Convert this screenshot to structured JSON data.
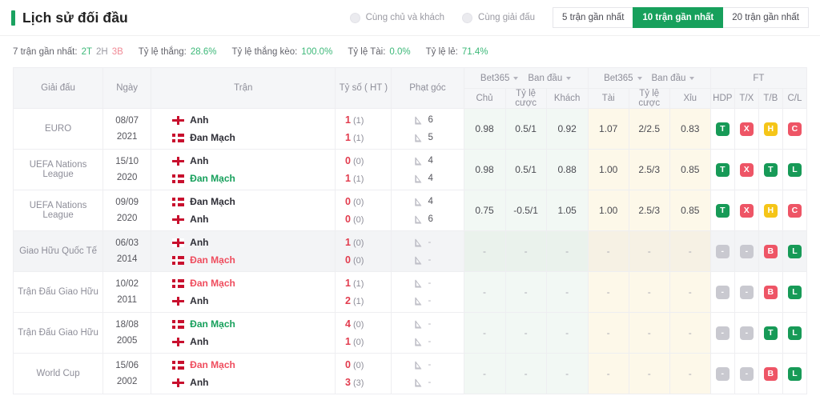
{
  "header": {
    "title": "Lịch sử đối đầu",
    "accent_color": "#1aa260",
    "filters": [
      {
        "name": "same-home-away",
        "label": "Cùng chủ và khách",
        "selected": false
      },
      {
        "name": "same-league",
        "label": "Cùng giải đấu",
        "selected": false
      }
    ],
    "range_buttons": [
      {
        "label": "5 trận gần nhất",
        "active": false
      },
      {
        "label": "10 trận gần nhất",
        "active": true
      },
      {
        "label": "20 trận gần nhất",
        "active": false
      }
    ]
  },
  "stats": {
    "recent_label": "7 trận gần nhất:",
    "wins": "2T",
    "draws": "2H",
    "losses": "3B",
    "win_rate_label": "Tỷ lệ thắng:",
    "win_rate_value": "28.6%",
    "handicap_label": "Tỷ lệ thắng kèo:",
    "handicap_value": "100.0%",
    "over_label": "Tỷ lệ Tài:",
    "over_value": "0.0%",
    "odds_label": "Tỷ lệ lẻ:",
    "odds_value": "71.4%"
  },
  "table": {
    "headers": {
      "league": "Giải đấu",
      "date": "Ngày",
      "match": "Trận",
      "score": "Tỷ số ( HT )",
      "corners": "Phạt góc",
      "group1_book": "Bet365",
      "group1_type": "Ban đầu",
      "group2_book": "Bet365",
      "group2_type": "Ban đầu",
      "ft": "FT",
      "home": "Chủ",
      "odds1": "Tỷ lệ cược",
      "away": "Khách",
      "over": "Tài",
      "odds2": "Tỷ lệ cược",
      "under": "Xỉu",
      "hdp": "HDP",
      "tx": "T/X",
      "tb": "T/B",
      "cl": "C/L"
    },
    "rows": [
      {
        "league": "EURO",
        "day": "08/07",
        "year": "2021",
        "home_team": "Anh",
        "home_flag": "england",
        "home_result": "draw",
        "away_team": "Đan Mạch",
        "away_flag": "denmark",
        "away_result": "draw",
        "home_score": "1",
        "home_ht": "(1)",
        "away_score": "1",
        "away_ht": "(1)",
        "corner_home": "6",
        "corner_away": "5",
        "o_home": "0.98",
        "o_line1": "0.5/1",
        "o_away": "0.92",
        "o_over": "1.07",
        "o_line2": "2/2.5",
        "o_under": "0.83",
        "ft": [
          "T",
          "X",
          "H",
          "C"
        ],
        "highlight": false
      },
      {
        "league": "UEFA Nations League",
        "day": "15/10",
        "year": "2020",
        "home_team": "Anh",
        "home_flag": "england",
        "home_result": "draw",
        "away_team": "Đan Mạch",
        "away_flag": "denmark",
        "away_result": "win",
        "home_score": "0",
        "home_ht": "(0)",
        "away_score": "1",
        "away_ht": "(1)",
        "corner_home": "4",
        "corner_away": "4",
        "o_home": "0.98",
        "o_line1": "0.5/1",
        "o_away": "0.88",
        "o_over": "1.00",
        "o_line2": "2.5/3",
        "o_under": "0.85",
        "ft": [
          "T",
          "X",
          "T",
          "L"
        ],
        "highlight": false
      },
      {
        "league": "UEFA Nations League",
        "day": "09/09",
        "year": "2020",
        "home_team": "Đan Mạch",
        "home_flag": "denmark",
        "home_result": "draw",
        "away_team": "Anh",
        "away_flag": "england",
        "away_result": "draw",
        "home_score": "0",
        "home_ht": "(0)",
        "away_score": "0",
        "away_ht": "(0)",
        "corner_home": "4",
        "corner_away": "6",
        "o_home": "0.75",
        "o_line1": "-0.5/1",
        "o_away": "1.05",
        "o_over": "1.00",
        "o_line2": "2.5/3",
        "o_under": "0.85",
        "ft": [
          "T",
          "X",
          "H",
          "C"
        ],
        "highlight": false
      },
      {
        "league": "Giao Hữu Quốc Tế",
        "day": "06/03",
        "year": "2014",
        "home_team": "Anh",
        "home_flag": "england",
        "home_result": "draw",
        "away_team": "Đan Mạch",
        "away_flag": "denmark",
        "away_result": "lose",
        "home_score": "1",
        "home_ht": "(0)",
        "away_score": "0",
        "away_ht": "(0)",
        "corner_home": "-",
        "corner_away": "-",
        "o_home": "-",
        "o_line1": "-",
        "o_away": "-",
        "o_over": "-",
        "o_line2": "-",
        "o_under": "-",
        "ft": [
          "-",
          "-",
          "B",
          "L"
        ],
        "highlight": true
      },
      {
        "league": "Trận Đấu Giao Hữu",
        "day": "10/02",
        "year": "2011",
        "home_team": "Đan Mạch",
        "home_flag": "denmark",
        "home_result": "lose",
        "away_team": "Anh",
        "away_flag": "england",
        "away_result": "draw",
        "home_score": "1",
        "home_ht": "(1)",
        "away_score": "2",
        "away_ht": "(1)",
        "corner_home": "-",
        "corner_away": "-",
        "o_home": "-",
        "o_line1": "-",
        "o_away": "-",
        "o_over": "-",
        "o_line2": "-",
        "o_under": "-",
        "ft": [
          "-",
          "-",
          "B",
          "L"
        ],
        "highlight": false
      },
      {
        "league": "Trận Đấu Giao Hữu",
        "day": "18/08",
        "year": "2005",
        "home_team": "Đan Mạch",
        "home_flag": "denmark",
        "home_result": "win",
        "away_team": "Anh",
        "away_flag": "england",
        "away_result": "draw",
        "home_score": "4",
        "home_ht": "(0)",
        "away_score": "1",
        "away_ht": "(0)",
        "corner_home": "-",
        "corner_away": "-",
        "o_home": "-",
        "o_line1": "-",
        "o_away": "-",
        "o_over": "-",
        "o_line2": "-",
        "o_under": "-",
        "ft": [
          "-",
          "-",
          "T",
          "L"
        ],
        "highlight": false
      },
      {
        "league": "World Cup",
        "day": "15/06",
        "year": "2002",
        "home_team": "Đan Mạch",
        "home_flag": "denmark",
        "home_result": "lose",
        "away_team": "Anh",
        "away_flag": "england",
        "away_result": "draw",
        "home_score": "0",
        "home_ht": "(0)",
        "away_score": "3",
        "away_ht": "(3)",
        "corner_home": "-",
        "corner_away": "-",
        "o_home": "-",
        "o_line1": "-",
        "o_away": "-",
        "o_over": "-",
        "o_line2": "-",
        "o_under": "-",
        "ft": [
          "-",
          "-",
          "B",
          "L"
        ],
        "highlight": false
      }
    ]
  }
}
